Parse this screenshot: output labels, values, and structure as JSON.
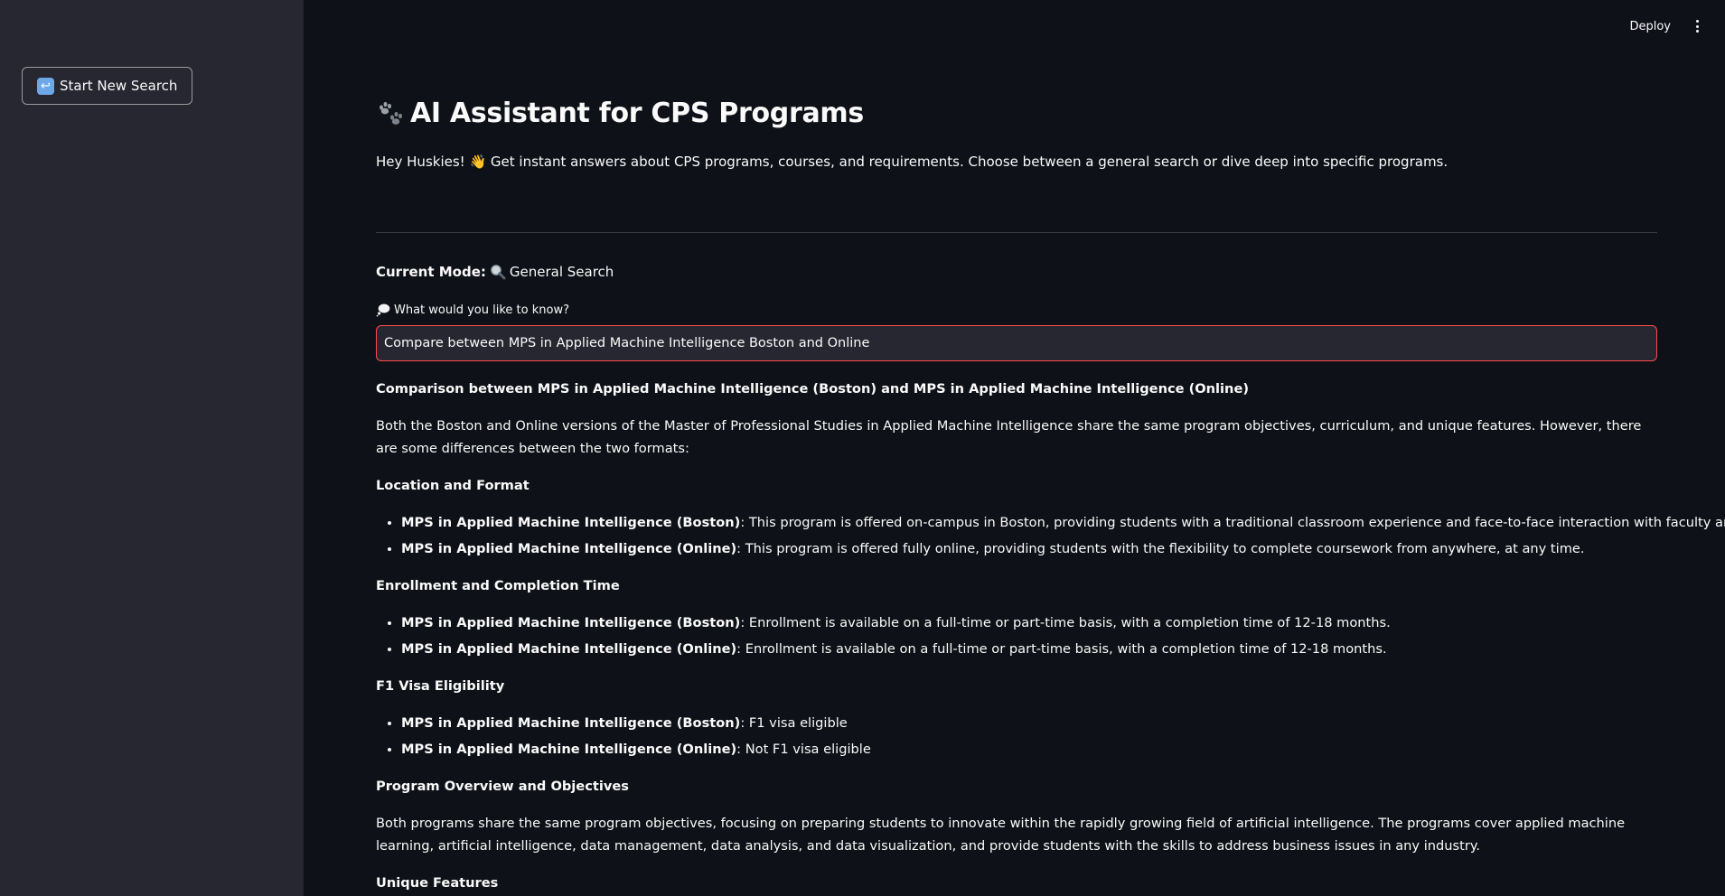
{
  "sidebar": {
    "new_search_label": "Start New Search",
    "new_search_icon": "return-arrow-icon"
  },
  "topbar": {
    "deploy_label": "Deploy",
    "menu_icon": "kebab-menu-icon"
  },
  "header": {
    "icon": "paw-prints-icon",
    "title": "AI Assistant for CPS Programs",
    "intro_prefix": "Hey Huskies!",
    "intro_emoji": "👋",
    "intro_text": "Get instant answers about CPS programs, courses, and requirements. Choose between a general search or dive deep into specific programs."
  },
  "mode": {
    "label": "Current Mode:",
    "icon": "magnifying-glass-icon",
    "value": "General Search"
  },
  "query": {
    "label_icon": "thought-bubble-icon",
    "label": "What would you like to know?",
    "value": "Compare between MPS in Applied Machine Intelligence Boston and Online"
  },
  "answer": {
    "heading": "Comparison between MPS in Applied Machine Intelligence (Boston) and MPS in Applied Machine Intelligence (Online)",
    "intro": "Both the Boston and Online versions of the Master of Professional Studies in Applied Machine Intelligence share the same program objectives, curriculum, and unique features. However, there are some differences between the two formats:",
    "sections": [
      {
        "title": "Location and Format",
        "items": [
          {
            "label": "MPS in Applied Machine Intelligence (Boston)",
            "text": ": This program is offered on-campus in Boston, providing students with a traditional classroom experience and face-to-face interaction with faculty and peers."
          },
          {
            "label": "MPS in Applied Machine Intelligence (Online)",
            "text": ": This program is offered fully online, providing students with the flexibility to complete coursework from anywhere, at any time."
          }
        ]
      },
      {
        "title": "Enrollment and Completion Time",
        "items": [
          {
            "label": "MPS in Applied Machine Intelligence (Boston)",
            "text": ": Enrollment is available on a full-time or part-time basis, with a completion time of 12-18 months."
          },
          {
            "label": "MPS in Applied Machine Intelligence (Online)",
            "text": ": Enrollment is available on a full-time or part-time basis, with a completion time of 12-18 months."
          }
        ]
      },
      {
        "title": "F1 Visa Eligibility",
        "items": [
          {
            "label": "MPS in Applied Machine Intelligence (Boston)",
            "text": ": F1 visa eligible"
          },
          {
            "label": "MPS in Applied Machine Intelligence (Online)",
            "text": ": Not F1 visa eligible"
          }
        ]
      }
    ],
    "overview_title": "Program Overview and Objectives",
    "overview_text": "Both programs share the same program objectives, focusing on preparing students to innovate within the rapidly growing field of artificial intelligence. The programs cover applied machine learning, artificial intelligence, data management, data analysis, and data visualization, and provide students with the skills to address business issues in any industry.",
    "unique_title": "Unique Features"
  }
}
